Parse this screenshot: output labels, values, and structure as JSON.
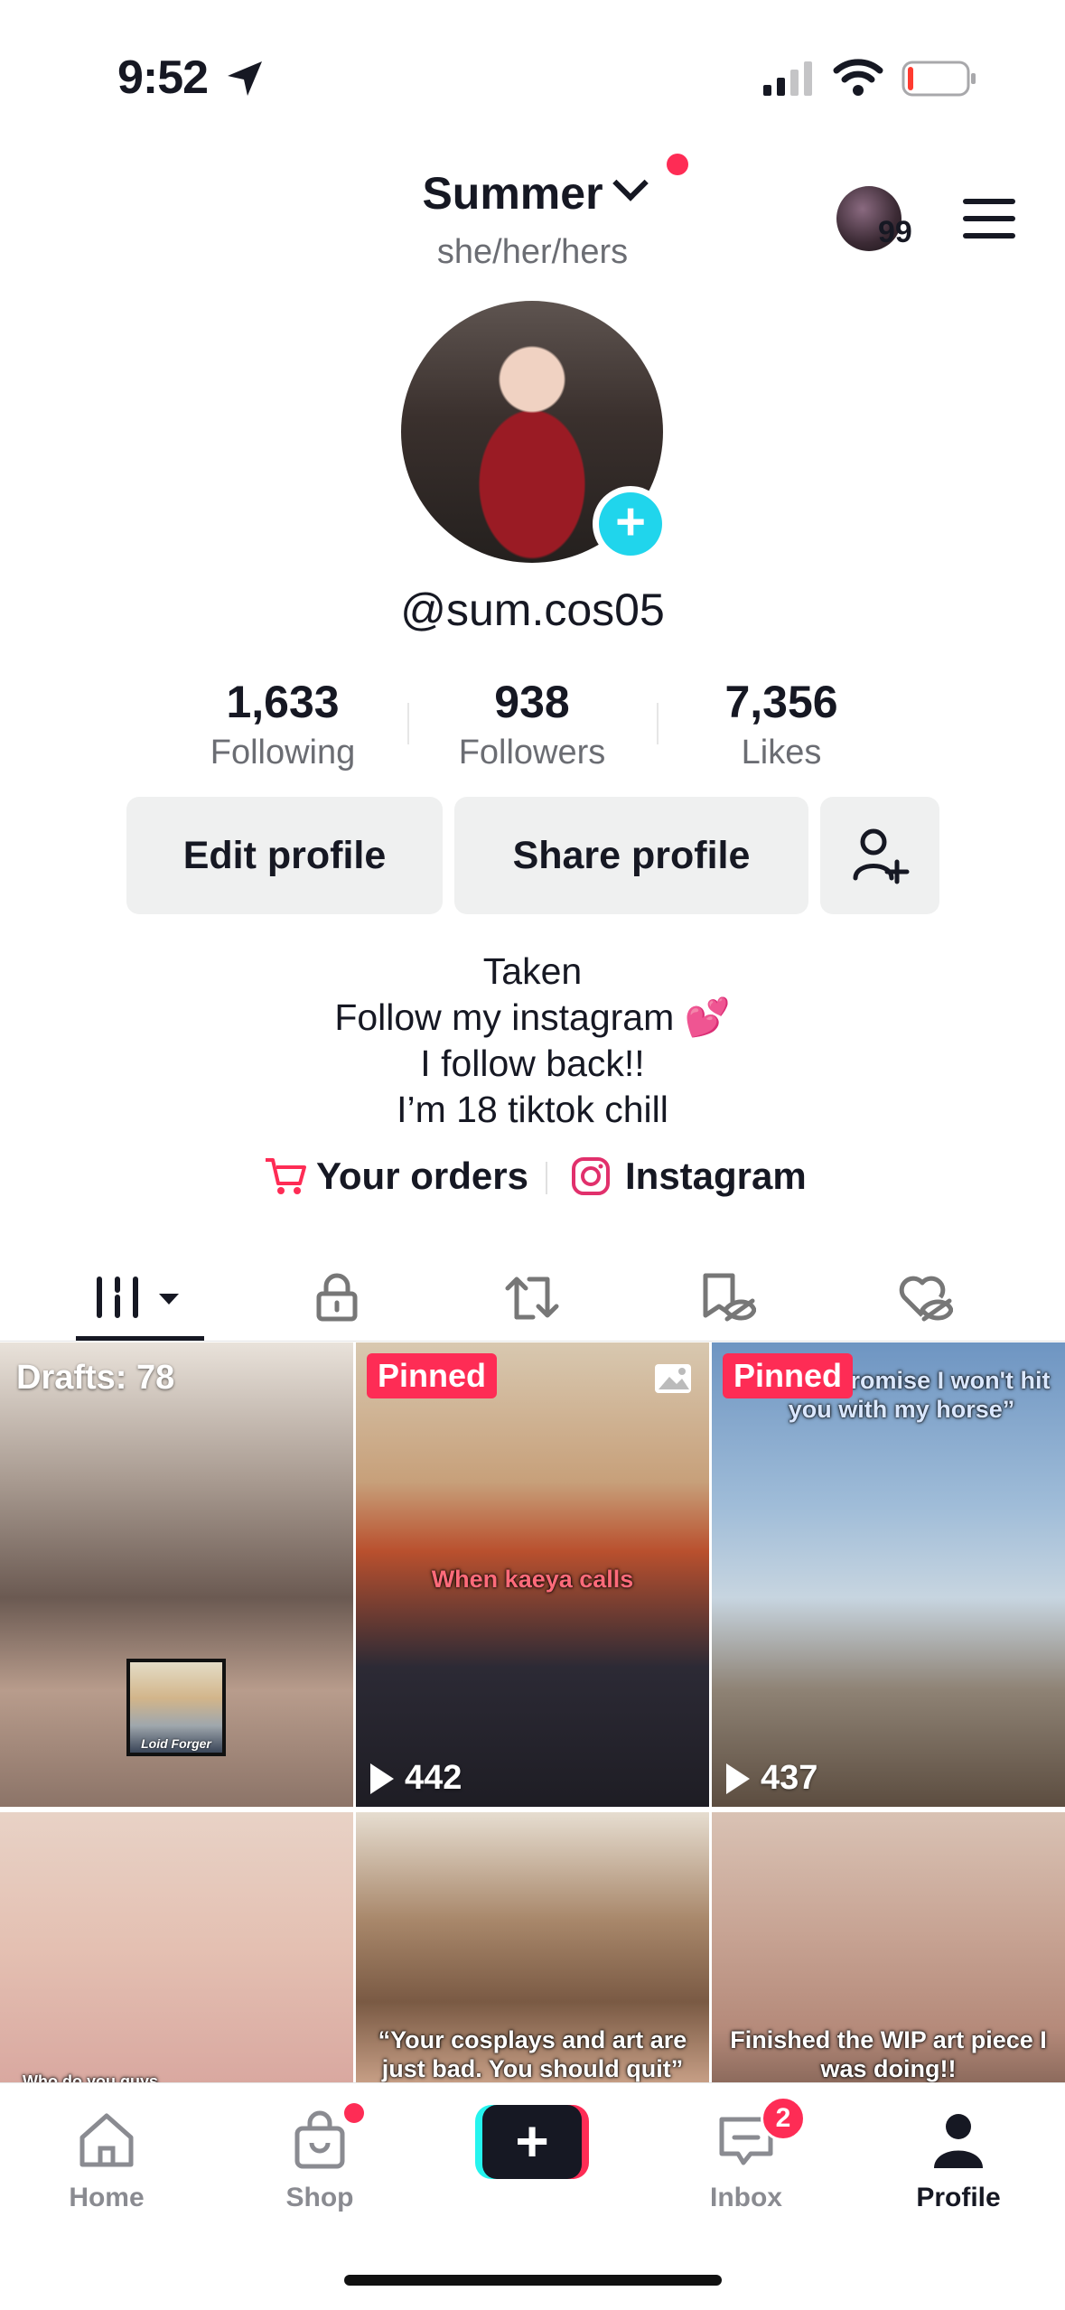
{
  "status_bar": {
    "time": "9:52"
  },
  "header": {
    "username": "Summer",
    "pronouns": "she/her/hers",
    "story_count": "99"
  },
  "profile": {
    "handle": "@sum.cos05"
  },
  "stats": [
    {
      "value": "1,633",
      "label": "Following"
    },
    {
      "value": "938",
      "label": "Followers"
    },
    {
      "value": "7,356",
      "label": "Likes"
    }
  ],
  "buttons": {
    "edit": "Edit profile",
    "share": "Share profile"
  },
  "bio": {
    "lines": [
      "Taken",
      "Follow my instagram 💕",
      "I follow back!!",
      "I’m 18 tiktok chill"
    ]
  },
  "links": {
    "orders": "Your orders",
    "instagram": "Instagram"
  },
  "tabs": [
    {
      "icon": "videos-grid-icon"
    },
    {
      "icon": "lock-icon"
    },
    {
      "icon": "repost-icon"
    },
    {
      "icon": "favorites-hidden-icon"
    },
    {
      "icon": "liked-hidden-icon"
    }
  ],
  "grid": [
    {
      "badge": "Drafts: 78",
      "sticker": "Loid Forger"
    },
    {
      "pinned": "Pinned",
      "caption": "When kaeya calls",
      "views": "442"
    },
    {
      "pinned": "Pinned",
      "caption": "e still I promise I won't hit you with my horse”",
      "views": "437"
    },
    {
      "caption": "Who do you guys wanna"
    },
    {
      "caption": "“Your cosplays and art are just bad. You should quit”"
    },
    {
      "caption": "Finished the WIP art piece I was doing!!"
    }
  ],
  "nav": {
    "items": [
      {
        "label": "Home"
      },
      {
        "label": "Shop"
      },
      {
        "label": ""
      },
      {
        "label": "Inbox",
        "badge": "2"
      },
      {
        "label": "Profile"
      }
    ]
  },
  "colors": {
    "accent": "#fe2c55",
    "cyan": "#20d5ec",
    "text": "#161823"
  }
}
